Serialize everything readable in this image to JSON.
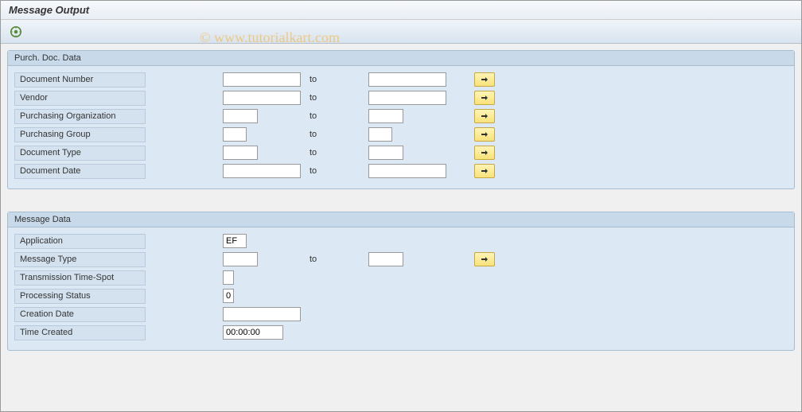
{
  "title": "Message Output",
  "watermark": "© www.tutorialkart.com",
  "groups": {
    "purchDoc": {
      "header": "Purch. Doc. Data",
      "rows": {
        "docNumber": {
          "label": "Document Number",
          "from": "",
          "to_label": "to",
          "to": ""
        },
        "vendor": {
          "label": "Vendor",
          "from": "",
          "to_label": "to",
          "to": ""
        },
        "purchOrg": {
          "label": "Purchasing Organization",
          "from": "",
          "to_label": "to",
          "to": ""
        },
        "purchGroup": {
          "label": "Purchasing Group",
          "from": "",
          "to_label": "to",
          "to": ""
        },
        "docType": {
          "label": "Document Type",
          "from": "",
          "to_label": "to",
          "to": ""
        },
        "docDate": {
          "label": "Document Date",
          "from": "",
          "to_label": "to",
          "to": ""
        }
      }
    },
    "messageData": {
      "header": "Message Data",
      "rows": {
        "application": {
          "label": "Application",
          "value": "EF"
        },
        "messageType": {
          "label": "Message Type",
          "from": "",
          "to_label": "to",
          "to": ""
        },
        "transTime": {
          "label": "Transmission Time-Spot",
          "value": ""
        },
        "procStatus": {
          "label": "Processing Status",
          "value": "0"
        },
        "creationDate": {
          "label": "Creation Date",
          "value": ""
        },
        "timeCreated": {
          "label": "Time Created",
          "value": "00:00:00"
        }
      }
    }
  }
}
